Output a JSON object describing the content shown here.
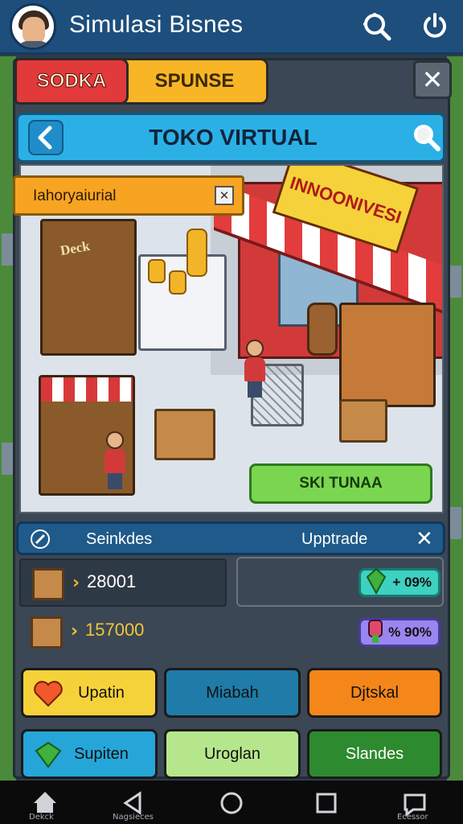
{
  "app": {
    "title": "Simulasi Bisnes"
  },
  "tabs": [
    {
      "label": "SODKA"
    },
    {
      "label": "SPUNSE"
    }
  ],
  "nav": {
    "title": "TOKO VIRTUAL"
  },
  "scene": {
    "tooltip": "Iahoryaiurial",
    "shop_sign": "INNOONIVESI",
    "shelf_sign": "Deck",
    "action_button": "SKI TUNAA"
  },
  "upgrade": {
    "left_label": "Seinkdes",
    "right_label": "Upptrade",
    "rows": [
      {
        "value": "28001",
        "pill": "+ 09%"
      },
      {
        "value": "157000",
        "pill": "% 90%"
      }
    ]
  },
  "buttons": [
    {
      "label": "Upatin"
    },
    {
      "label": "Miabah"
    },
    {
      "label": "Djtskal"
    },
    {
      "label": "Supiten"
    },
    {
      "label": "Uroglan"
    },
    {
      "label": "Slandes"
    }
  ],
  "system_nav": {
    "home_label": "Dekck",
    "back_label": "Nagsieces",
    "recent_label": "Ecessor"
  },
  "colors": {
    "appbar": "#1d4e7c",
    "accent": "#2bb0e6",
    "gold": "#f2b528"
  },
  "icons": [
    "search-icon",
    "power-icon",
    "close-icon",
    "back-icon",
    "edit-icon",
    "heart-icon",
    "gem-icon",
    "home-icon",
    "recent-icon",
    "chat-icon"
  ]
}
